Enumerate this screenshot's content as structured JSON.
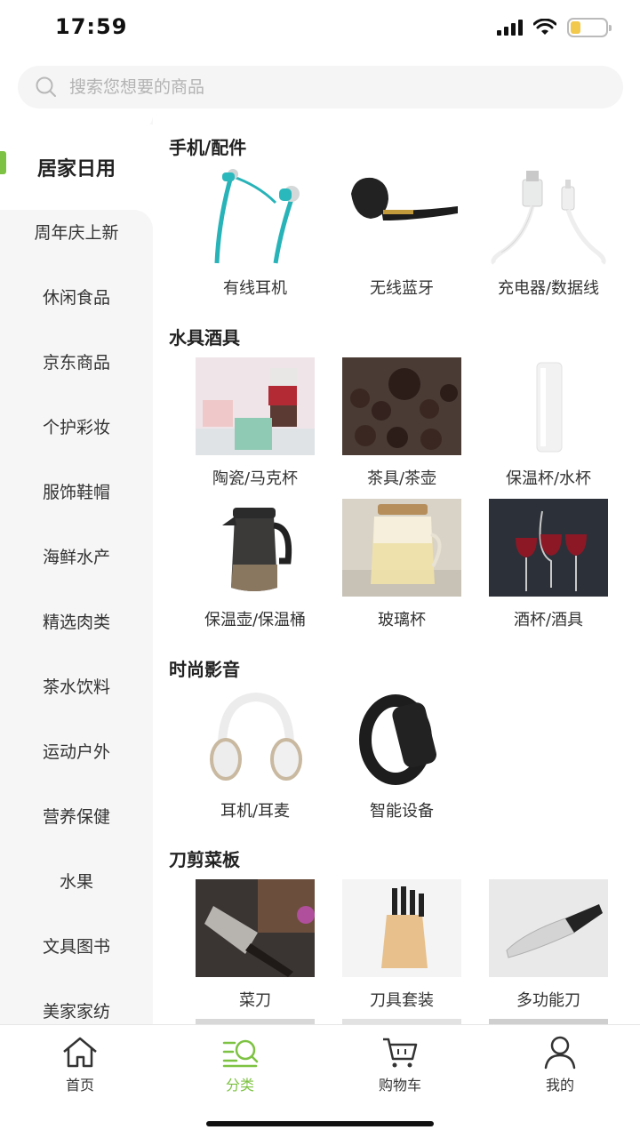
{
  "status_bar": {
    "time": "17:59"
  },
  "search": {
    "placeholder": "搜索您想要的商品"
  },
  "sidebar": {
    "active": "居家日用",
    "items": [
      "周年庆上新",
      "休闲食品",
      "京东商品",
      "个护彩妆",
      "服饰鞋帽",
      "海鲜水产",
      "精选肉类",
      "茶水饮料",
      "运动户外",
      "营养保健",
      "水果",
      "文具图书",
      "美家家纺"
    ]
  },
  "sections": [
    {
      "title": "手机/配件",
      "products": [
        "有线耳机",
        "无线蓝牙",
        "充电器/数据线"
      ]
    },
    {
      "title": "水具酒具",
      "products": [
        "陶瓷/马克杯",
        "茶具/茶壶",
        "保温杯/水杯",
        "保温壶/保温桶",
        "玻璃杯",
        "酒杯/酒具"
      ]
    },
    {
      "title": "时尚影音",
      "products": [
        "耳机/耳麦",
        "智能设备"
      ]
    },
    {
      "title": "刀剪菜板",
      "products": [
        "菜刀",
        "刀具套装",
        "多功能刀"
      ]
    }
  ],
  "bottom_nav": {
    "items": [
      {
        "label": "首页",
        "icon": "home-icon"
      },
      {
        "label": "分类",
        "icon": "category-search-icon"
      },
      {
        "label": "购物车",
        "icon": "cart-icon"
      },
      {
        "label": "我的",
        "icon": "profile-icon"
      }
    ],
    "active_index": 1
  },
  "colors": {
    "accent": "#7dc242",
    "sidebar_bg": "#f5f6f5"
  }
}
